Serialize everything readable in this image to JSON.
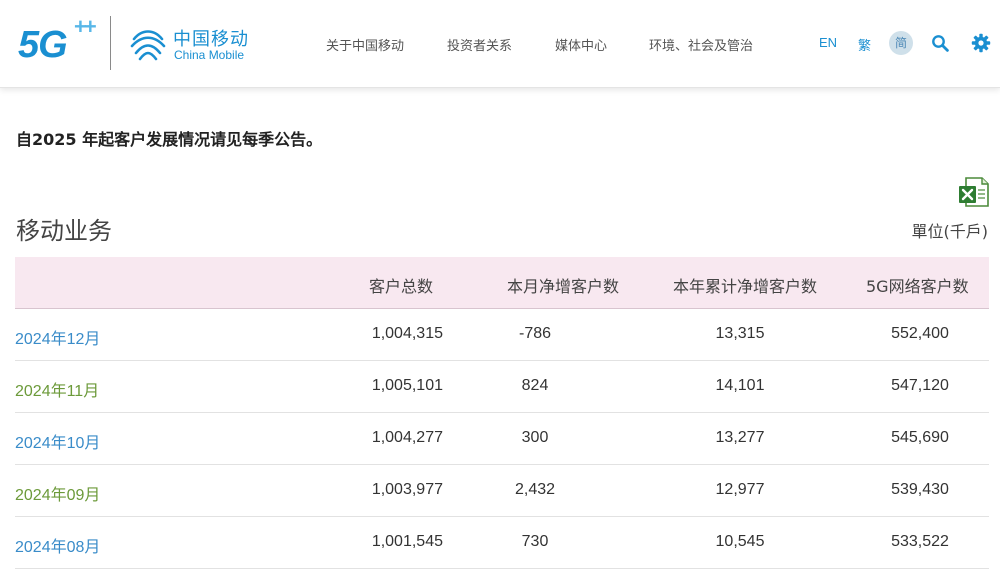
{
  "header": {
    "logo_5g": {
      "text": "5G",
      "plus": "++",
      "color": "#1a8fd1"
    },
    "brand": {
      "name_cn": "中国移动",
      "name_en": "China Mobile",
      "color": "#1a8fd1",
      "icon": "china-mobile-emblem-icon"
    },
    "nav": [
      {
        "label": "关于中国移动"
      },
      {
        "label": "投资者关系"
      },
      {
        "label": "媒体中心"
      },
      {
        "label": "环境、社会及管治"
      }
    ],
    "languages": {
      "en": "EN",
      "traditional": "繁",
      "simplified": "简"
    },
    "icons": {
      "search": "search-icon",
      "settings": "gear-icon"
    }
  },
  "notice": "自2025 年起客户发展情况请见每季公告。",
  "section": {
    "title": "移动业务",
    "unit": "單位(千戶)",
    "export_icon": "excel-icon"
  },
  "table": {
    "header_bg": "#f8e8f0",
    "columns": [
      "",
      "客户总数",
      "本月净增客户数",
      "本年累计净增客户数",
      "5G网络客户数"
    ],
    "link_colors": {
      "blue": "#3a8cc9",
      "green": "#6c9a3a"
    },
    "rows": [
      {
        "month": "2024年12月",
        "total": "1,004,315",
        "monthly_net_add": "-786",
        "ytd_net_add": "13,315",
        "subscribers_5g": "552,400",
        "color": "blue"
      },
      {
        "month": "2024年11月",
        "total": "1,005,101",
        "monthly_net_add": "824",
        "ytd_net_add": "14,101",
        "subscribers_5g": "547,120",
        "color": "green"
      },
      {
        "month": "2024年10月",
        "total": "1,004,277",
        "monthly_net_add": "300",
        "ytd_net_add": "13,277",
        "subscribers_5g": "545,690",
        "color": "blue"
      },
      {
        "month": "2024年09月",
        "total": "1,003,977",
        "monthly_net_add": "2,432",
        "ytd_net_add": "12,977",
        "subscribers_5g": "539,430",
        "color": "green"
      },
      {
        "month": "2024年08月",
        "total": "1,001,545",
        "monthly_net_add": "730",
        "ytd_net_add": "10,545",
        "subscribers_5g": "533,522",
        "color": "blue"
      }
    ]
  }
}
